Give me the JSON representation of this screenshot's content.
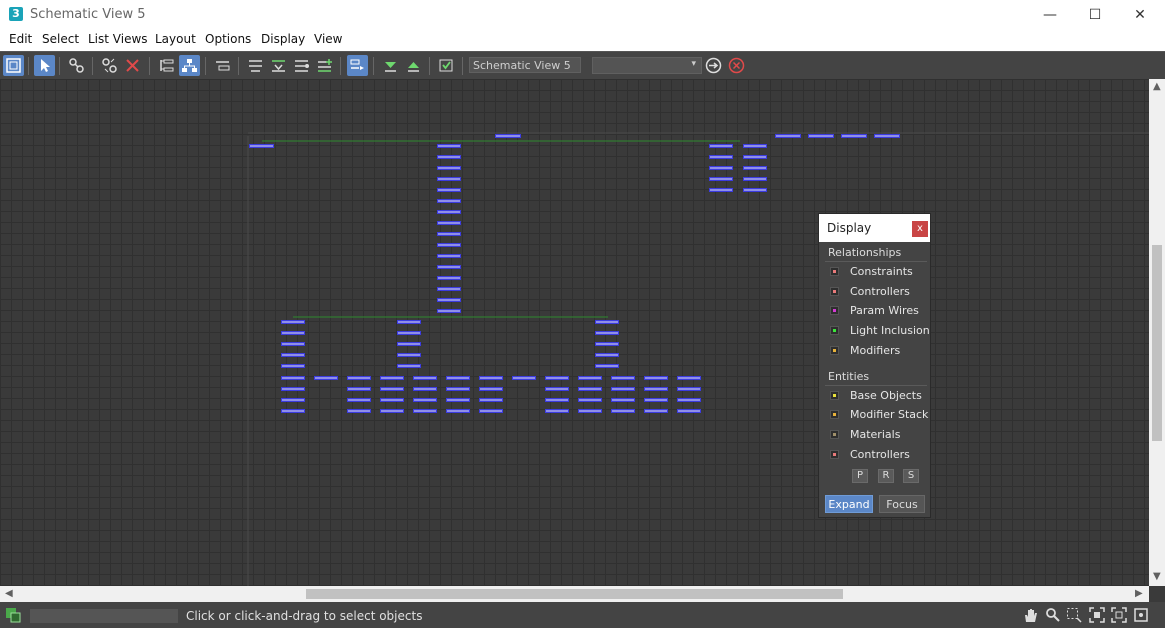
{
  "window": {
    "title": "Schematic View 5",
    "app_icon_glyph": "3",
    "minimize_glyph": "—",
    "maximize_glyph": "☐",
    "close_glyph": "✕"
  },
  "menu": [
    "Edit",
    "Select",
    "List Views",
    "Layout",
    "Options",
    "Display",
    "View"
  ],
  "toolbar": {
    "name_field_value": "Schematic View 5",
    "dropdown_value": "",
    "dropdown_arrow": "▾"
  },
  "display_panel": {
    "title": "Display",
    "close_label": "x",
    "relationships_title": "Relationships",
    "relationships": [
      {
        "label": "Constraints",
        "color": "#e87a7a"
      },
      {
        "label": "Controllers",
        "color": "#e87a7a"
      },
      {
        "label": "Param Wires",
        "color": "#d43ad4"
      },
      {
        "label": "Light Inclusion",
        "color": "#3ae83a"
      },
      {
        "label": "Modifiers",
        "color": "#e8b23a"
      }
    ],
    "entities_title": "Entities",
    "entities": [
      {
        "label": "Base Objects",
        "color": "#e8e23a"
      },
      {
        "label": "Modifier Stack",
        "color": "#e8b23a"
      },
      {
        "label": "Materials",
        "color": "#a0906a"
      },
      {
        "label": "Controllers",
        "color": "#e87a7a"
      }
    ],
    "prs": [
      "P",
      "R",
      "S"
    ],
    "expand_label": "Expand",
    "focus_label": "Focus"
  },
  "status": {
    "text": "Click or click-and-drag to select objects"
  },
  "colors": {
    "accent": "#5b87c7",
    "node_fill": "#8f8fe8",
    "node_border": "#3c3ce0",
    "wire": "#2e8b2e"
  }
}
